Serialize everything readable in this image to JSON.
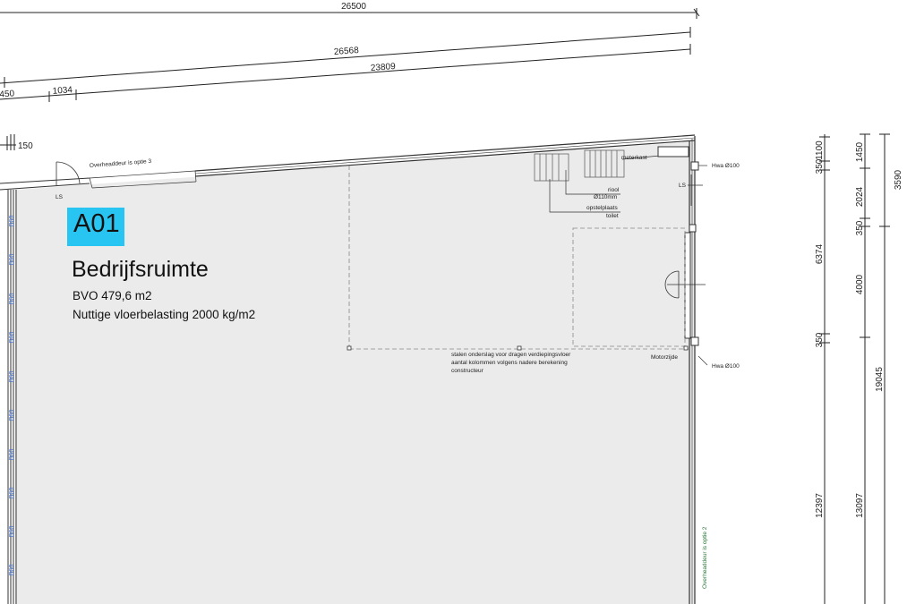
{
  "dimensions_top": {
    "total_width": "26500",
    "sloped_total": "26568",
    "sloped_segment": "23809",
    "segment_left": "450",
    "segment_mid": "1034",
    "segment_small": "150"
  },
  "dimensions_right": {
    "col1": [
      "1100",
      "350",
      "6374",
      "350",
      "12397"
    ],
    "col2": [
      "1450",
      "2024",
      "350",
      "4000",
      "13097"
    ],
    "col3": [
      "3590",
      "19045"
    ]
  },
  "annotations": {
    "door_option_3": "Overheaddeur is optie 3",
    "door_option_2": "Overheaddeur is optie 2",
    "ls_left": "LS",
    "ls_right": "LS",
    "meterkast": "meterkast",
    "riool_line1": "riool",
    "riool_line2": "Ø110mm",
    "toilet_line1": "opstelplaats",
    "toilet_line2": "toilet",
    "hwa_top": "Hwa Ø100",
    "hwa_bottom": "Hwa Ø100",
    "motorzijde": "Motorzijde",
    "steel_line1": "stalen onderslag voor dragen verdiepingsvloer",
    "steel_line2": "aantal kolommen volgens nadere berekening",
    "steel_line3": "constructeur",
    "column_label": "B60"
  },
  "room": {
    "code": "A01",
    "name": "Bedrijfsruimte",
    "bvo": "BVO 479,6 m2",
    "floor_load": "Nuttige vloerbelasting 2000 kg/m2"
  },
  "colors": {
    "badge": "#28c5f2",
    "floor": "#ebebeb",
    "column_labels": "#3a6fd8"
  }
}
